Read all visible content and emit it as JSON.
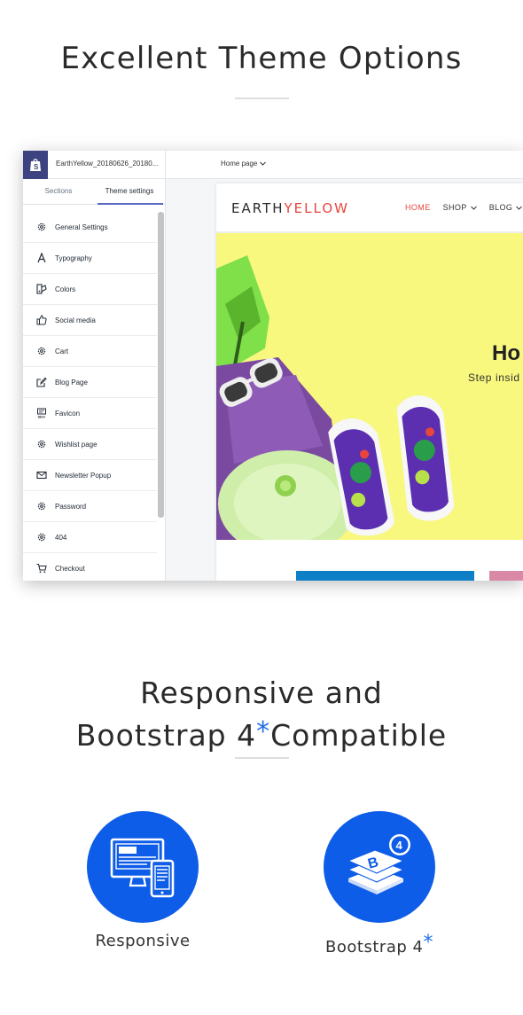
{
  "heading_theme": "Excellent Theme Options",
  "app": {
    "file_name": "EarthYellow_20180626_20180...",
    "page_select": "Home page",
    "tabs": [
      "Sections",
      "Theme settings"
    ],
    "menu": [
      {
        "label": "General Settings",
        "icon": "gear-icon"
      },
      {
        "label": "Typography",
        "icon": "typography-icon"
      },
      {
        "label": "Colors",
        "icon": "palette-icon"
      },
      {
        "label": "Social media",
        "icon": "thumbs-up-icon"
      },
      {
        "label": "Cart",
        "icon": "gear-icon"
      },
      {
        "label": "Blog Page",
        "icon": "edit-icon"
      },
      {
        "label": "Favicon",
        "icon": "favicon-icon"
      },
      {
        "label": "Wishlist page",
        "icon": "gear-icon"
      },
      {
        "label": "Newsletter Popup",
        "icon": "mail-icon"
      },
      {
        "label": "Password",
        "icon": "gear-icon"
      },
      {
        "label": "404",
        "icon": "gear-icon"
      },
      {
        "label": "Checkout",
        "icon": "cart-icon"
      }
    ]
  },
  "store": {
    "logo_a": "EARTH",
    "logo_b": "YELLOW",
    "nav": [
      "HOME",
      "SHOP",
      "BLOG"
    ],
    "hero_title": "Ho",
    "hero_subtitle": "Step insid"
  },
  "heading_bootstrap": {
    "line1": "Responsive and",
    "line2_text": "Bootstrap 4",
    "line2_star": "*",
    "line2_tail": "Compatible"
  },
  "features": [
    {
      "label": "Responsive",
      "icon": "responsive-devices-icon"
    },
    {
      "label": "Bootstrap 4",
      "star": "*",
      "icon": "bootstrap-icon"
    }
  ],
  "colors": {
    "accent_blue": "#0e5de8",
    "brand_red": "#e8463d",
    "hero_yellow": "#f8f77e",
    "shopify_purple": "#3d4380"
  }
}
